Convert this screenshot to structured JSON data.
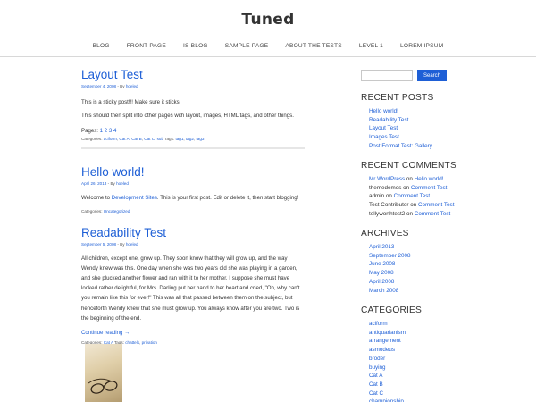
{
  "site": {
    "title": "Tuned"
  },
  "nav": {
    "items": [
      {
        "label": "BLOG"
      },
      {
        "label": "FRONT PAGE"
      },
      {
        "label": "IS BLOG"
      },
      {
        "label": "SAMPLE PAGE"
      },
      {
        "label": "ABOUT THE TESTS"
      },
      {
        "label": "LEVEL 1"
      },
      {
        "label": "LOREM IPSUM"
      }
    ]
  },
  "posts": {
    "layout": {
      "title": "Layout Test",
      "date": "September 4, 2008",
      "by": " - By ",
      "author": "hoeled",
      "p1": "This is a sticky post!!! Make sure it sticks!",
      "p2": "This should then split into other pages with layout, images, HTML tags, and other things.",
      "pages_label": "Pages: ",
      "pages": [
        "1",
        "2",
        "3",
        "4"
      ],
      "cat_label": "Categories: ",
      "cats": [
        "aciform",
        "Cat A",
        "Cat B",
        "Cat C",
        "sub"
      ],
      "tags_label": " Tags: ",
      "tags": [
        "tag1",
        "tag2",
        "tag3"
      ]
    },
    "hello": {
      "title": "Hello world!",
      "date": "April 26, 2013",
      "by": " - By ",
      "author": "hoeled",
      "text_before": "Welcome to ",
      "link": "Development Sites",
      "text_after": ". This is your first post. Edit or delete it, then start blogging!",
      "cat_label": "Categories: ",
      "cat": "Uncategorized"
    },
    "readability": {
      "title": "Readability Test",
      "date": "September 5, 2008",
      "by": " - By ",
      "author": "hoeled",
      "body": "All children, except one, grow up. They soon know that they will grow up, and the way Wendy knew was this. One day when she was two years old she was playing in a garden, and she plucked another flower and ran with it to her mother. I suppose she must have looked rather delightful, for Mrs. Darling put her hand to her heart and cried, \"Oh, why can't you remain like this for ever!\" This was all that passed between them on the subject, but henceforth Wendy knew that she must grow up. You always know after you are two. Two is the beginning of the end.",
      "continue": "Continue reading →",
      "cat_label": "Categories: ",
      "cat": "Cat A",
      "tags_label": " Tags: ",
      "tags": [
        "chattels",
        "privation"
      ]
    }
  },
  "sidebar": {
    "search_button": "Search",
    "recent_posts": {
      "title": "RECENT POSTS",
      "items": [
        "Hello world!",
        "Readability Test",
        "Layout Test",
        "Images Test",
        "Post Format Test: Gallery"
      ]
    },
    "recent_comments": {
      "title": "RECENT COMMENTS",
      "items": [
        {
          "author": "Mr WordPress",
          "on": " on ",
          "post": "Hello world!",
          "author_link": true
        },
        {
          "author": "themedemos",
          "on": " on ",
          "post": "Comment Test",
          "author_link": false
        },
        {
          "author": "admin",
          "on": " on ",
          "post": "Comment Test",
          "author_link": false
        },
        {
          "author": "Test Contributor",
          "on": " on ",
          "post": "Comment Test",
          "author_link": false
        },
        {
          "author": "tellyworthtest2",
          "on": " on ",
          "post": "Comment Test",
          "author_link": false
        }
      ]
    },
    "archives": {
      "title": "ARCHIVES",
      "items": [
        "April 2013",
        "September 2008",
        "June 2008",
        "May 2008",
        "April 2008",
        "March 2008"
      ]
    },
    "categories": {
      "title": "CATEGORIES",
      "items": [
        "aciform",
        "antiquarianism",
        "arrangement",
        "asmodeus",
        "broder",
        "buying",
        "Cat A",
        "Cat B",
        "Cat C",
        "championship"
      ]
    }
  },
  "colors": {
    "link": "#1e5fd6",
    "text": "#333333",
    "button": "#1e5fd6"
  }
}
